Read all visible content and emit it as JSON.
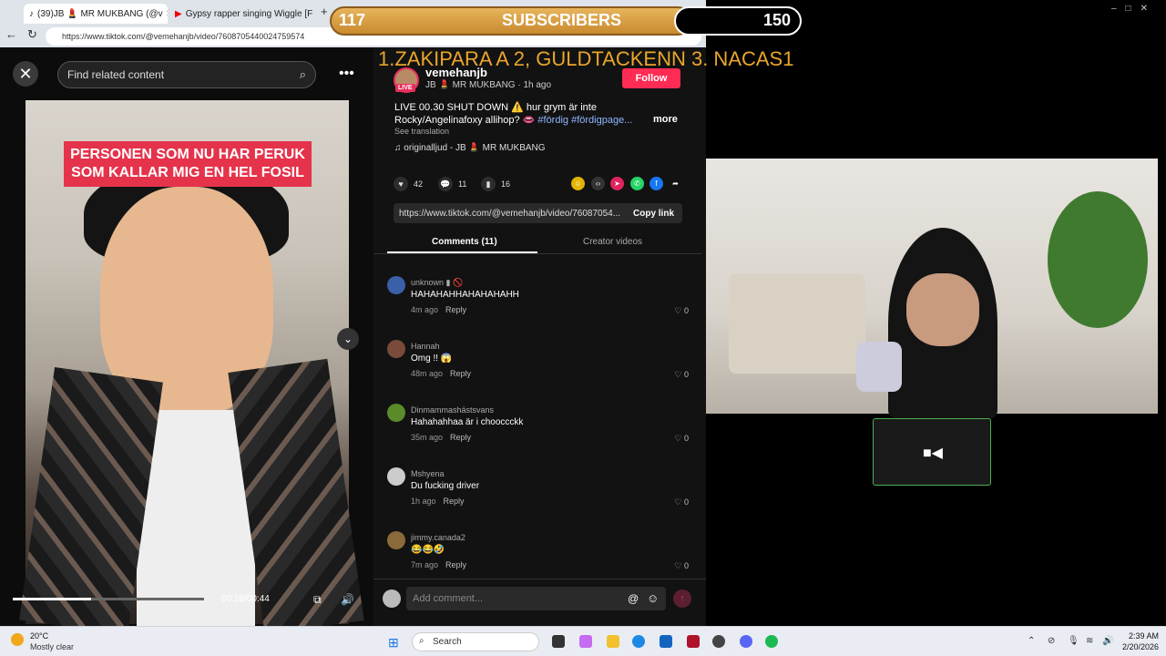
{
  "browser": {
    "tabs": [
      {
        "label": "(39)JB 💄 MR MUKBANG (@v",
        "active": true
      },
      {
        "label": "Gypsy rapper singing Wiggle [FUN",
        "active": false
      }
    ],
    "url": "https://www.tiktok.com/@vemehanjb/video/7608705440024759574"
  },
  "video": {
    "search_placeholder": "Find related content",
    "caption_line1": "PERSONEN SOM NU HAR PERUK",
    "caption_line2": "SOM KALLAR MIG EN HEL FOSIL",
    "time": "00:18/00:44",
    "progress": 0.41
  },
  "post": {
    "username": "vemehanjb",
    "live_badge": "LIVE",
    "subline": "JB 💄 MR MUKBANG · 1h ago",
    "follow_label": "Follow",
    "description_text": "LIVE 00.30 SHUT DOWN ⚠️ hur grym är inte Rocky/Angelinafoxy allihop? 👄 ",
    "description_tags": "#fördig #fördigpage...",
    "more_label": "more",
    "see_translation": "See translation",
    "music": "♫  originalljud - JB 💄 MR MUKBANG",
    "likes": "42",
    "comments": "11",
    "saves": "16",
    "link": "https://www.tiktok.com/@vemehanjb/video/76087054...",
    "copy_link_label": "Copy link",
    "tab_comments": "Comments (11)",
    "tab_creator": "Creator videos"
  },
  "comments": [
    {
      "name": "unknown ▮ 🚫",
      "text": "HAHAHAHHAHAHAHAHH",
      "time": "4m ago",
      "reply": "Reply",
      "likes": "0",
      "avatar_color": "#3b5fa8"
    },
    {
      "name": "Hannah",
      "text": "Omg !! 😱",
      "time": "48m ago",
      "reply": "Reply",
      "likes": "0",
      "avatar_color": "#7a4a3a"
    },
    {
      "name": "Dinmammashästsvans",
      "text": "Hahahahhaa är i chooccckk",
      "time": "35m ago",
      "reply": "Reply",
      "likes": "0",
      "avatar_color": "#5a8a2a"
    },
    {
      "name": "Mshyena",
      "text": "Du fucking driver",
      "time": "1h ago",
      "reply": "Reply",
      "likes": "0",
      "avatar_color": "#cccccc"
    },
    {
      "name": "jimmy.canada2",
      "text": "😂😂🤣",
      "time": "7m ago",
      "reply": "Reply",
      "likes": "0",
      "avatar_color": "#8a6a3a"
    }
  ],
  "comment_bar": {
    "placeholder": "Add comment..."
  },
  "overlay": {
    "sub_count_left": "117",
    "sub_title": "SUBSCRIBERS",
    "sub_count_right": "150",
    "leaderboard": "1.ZAKIPARA A 2, GULDTACKENN  3.  NACAS1"
  },
  "taskbar": {
    "temp": "20°C",
    "condition": "Mostly clear",
    "search": "Search",
    "time": "2:39 AM",
    "date": "2/20/2026"
  }
}
